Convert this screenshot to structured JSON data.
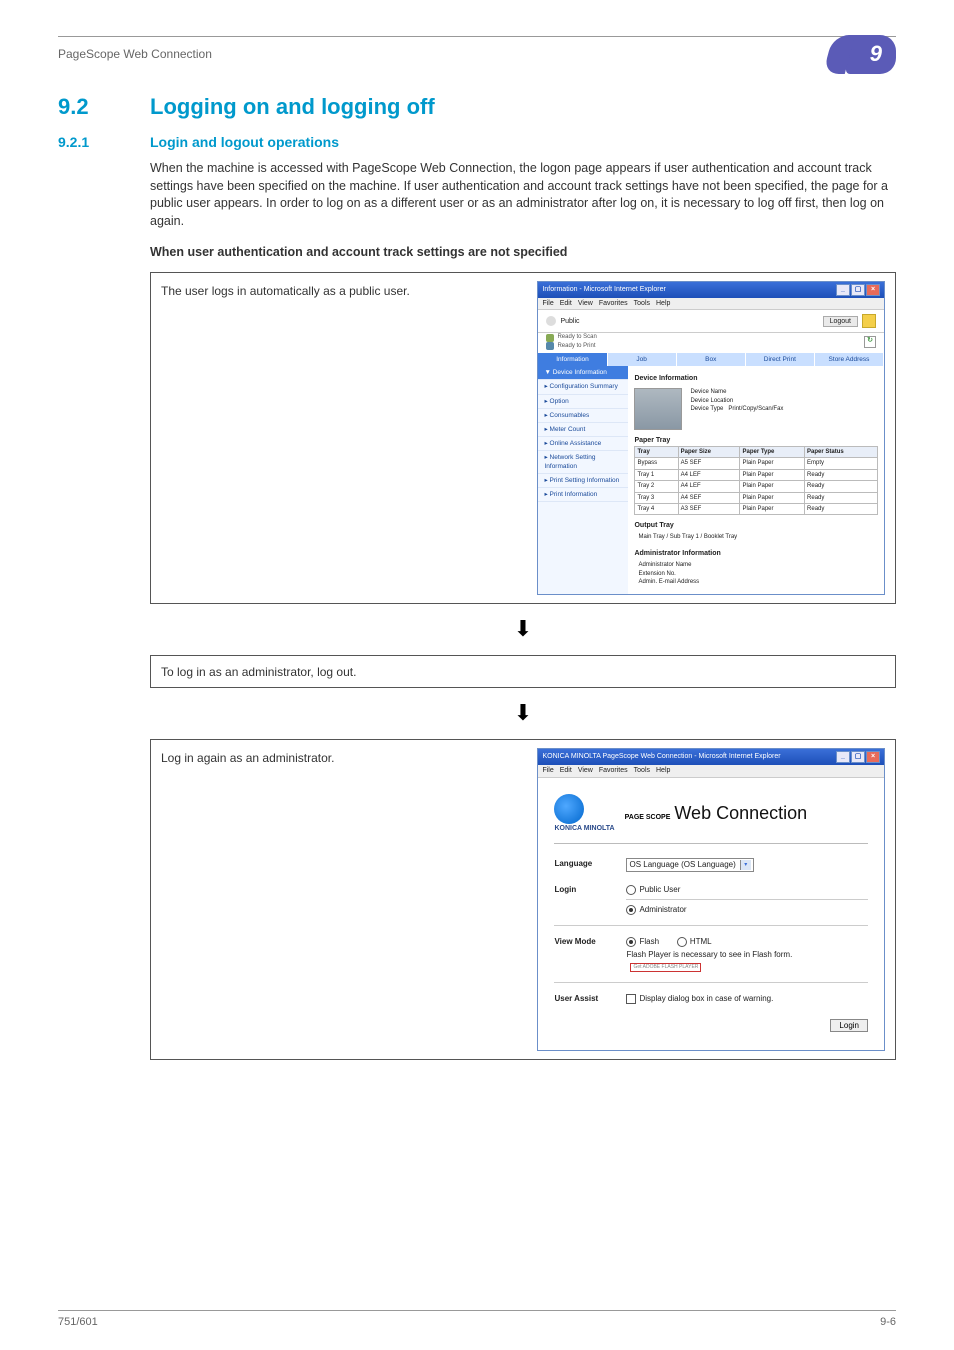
{
  "header": {
    "crumb": "PageScope Web Connection",
    "chapter": "9"
  },
  "section_h2_num": "9.2",
  "section_h2_title": "Logging on and logging off",
  "section_h3_num": "9.2.1",
  "section_h3_title": "Login and logout operations",
  "intro": "When the machine is accessed with PageScope Web Connection, the logon page appears if user authentication and account track settings have been specified on the machine. If user authentication and account track settings have not been specified, the page for a public user appears. In order to log on as a different user or as an administrator after log on, it is necessary to log off first, then log on again.",
  "subhead": "When user authentication and account track settings are not specified",
  "steps": {
    "s1_caption": "The user logs in automatically as a public user.",
    "s2_caption": "To log in as an administrator, log out.",
    "s3_caption": "Log in again as an administrator."
  },
  "ie1": {
    "title": "Information - Microsoft Internet Explorer",
    "menu": [
      "File",
      "Edit",
      "View",
      "Favorites",
      "Tools",
      "Help"
    ],
    "user_label": "Public",
    "logout": "Logout",
    "status_scan": "Ready to Scan",
    "status_print": "Ready to Print",
    "tabs": [
      "Information",
      "Job",
      "Box",
      "Direct Print",
      "Store Address"
    ],
    "sidenav": [
      "Device Information",
      "Configuration Summary",
      "Option",
      "Consumables",
      "Meter Count",
      "Online Assistance",
      "Network Setting Information",
      "Print Setting Information",
      "Print Information"
    ],
    "panel_title": "Device Information",
    "dev_name_l": "Device Name",
    "dev_loc_l": "Device Location",
    "dev_type_l": "Device Type",
    "dev_type_v": "Print/Copy/Scan/Fax",
    "paper_tray": "Paper Tray",
    "pt_headers": [
      "Tray",
      "Paper Size",
      "Paper Type",
      "Paper Status"
    ],
    "pt_rows": [
      [
        "Bypass",
        "A5 SEF",
        "Plain Paper",
        "Empty"
      ],
      [
        "Tray 1",
        "A4 LEF",
        "Plain Paper",
        "Ready"
      ],
      [
        "Tray 2",
        "A4 LEF",
        "Plain Paper",
        "Ready"
      ],
      [
        "Tray 3",
        "A4 SEF",
        "Plain Paper",
        "Ready"
      ],
      [
        "Tray 4",
        "A3 SEF",
        "Plain Paper",
        "Ready"
      ]
    ],
    "output_tray": "Output Tray",
    "output_tray_v": "Main Tray / Sub Tray 1 / Booklet Tray",
    "admin_info": "Administrator Information",
    "admin_name_l": "Administrator Name",
    "admin_ext_l": "Extension No.",
    "admin_mail_l": "Admin. E-mail Address"
  },
  "ie2": {
    "title": "KONICA MINOLTA PageScope Web Connection - Microsoft Internet Explorer",
    "menu": [
      "File",
      "Edit",
      "View",
      "Favorites",
      "Tools",
      "Help"
    ],
    "brand_name": "KONICA MINOLTA",
    "brand_ps": "PAGE SCOPE",
    "brand_title": "Web Connection",
    "lang_l": "Language",
    "lang_v": "OS Language (OS Language)",
    "login_l": "Login",
    "login_opt_public": "Public User",
    "login_opt_admin": "Administrator",
    "view_l": "View Mode",
    "view_flash": "Flash",
    "view_html": "HTML",
    "flash_note": "Flash Player is necessary to see in Flash form.",
    "flash_badge": "Get ADOBE FLASH PLAYER",
    "assist_l": "User Assist",
    "assist_opt": "Display dialog box in case of warning.",
    "login_btn": "Login"
  },
  "footer": {
    "left": "751/601",
    "right": "9-6"
  }
}
